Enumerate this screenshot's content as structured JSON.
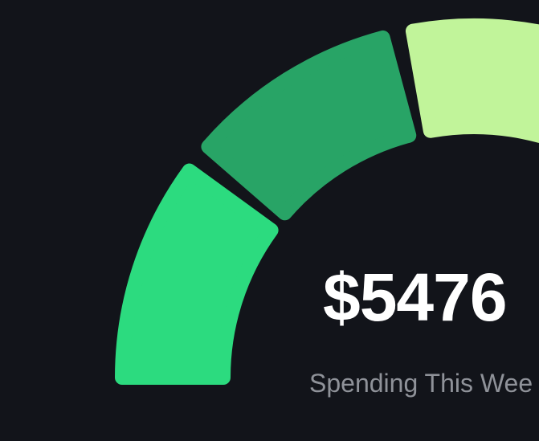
{
  "summary": {
    "amount": "$5476",
    "caption": "Spending This Wee"
  },
  "gauge": {
    "segments": [
      {
        "name": "segment-1",
        "color": "#2cdb7f"
      },
      {
        "name": "segment-2",
        "color": "#28a466"
      },
      {
        "name": "segment-3",
        "color": "#c1f49a"
      }
    ]
  }
}
